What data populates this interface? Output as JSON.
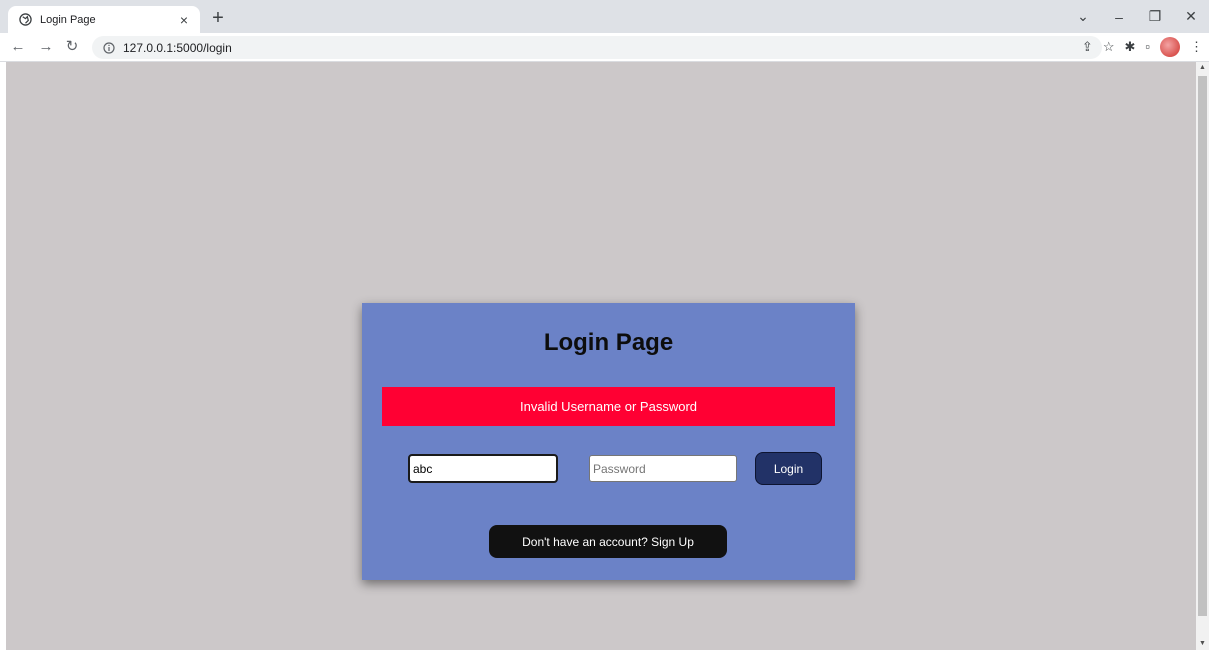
{
  "browser": {
    "tab_title": "Login Page",
    "tab_close": "×",
    "new_tab": "+",
    "url": "127.0.0.1:5000/login",
    "window_controls": {
      "dropdown": "⌄",
      "minimize": "–",
      "restore": "❐",
      "close": "✕"
    }
  },
  "page": {
    "title": "Login Page",
    "error_message": "Invalid Username or Password",
    "username_value": "abc",
    "password_placeholder": "Password",
    "login_label": "Login",
    "signup_label": "Don't have an account? Sign Up"
  },
  "colors": {
    "background": "#ccc8c9",
    "card": "#6b82c7",
    "error": "#ff0033",
    "login_button": "#223267",
    "signup_button": "#111111"
  },
  "icons": [
    "globe-icon",
    "close-icon",
    "plus-icon",
    "back-icon",
    "forward-icon",
    "reload-icon",
    "info-icon",
    "share-icon",
    "star-icon",
    "extensions-icon",
    "side-panel-icon",
    "avatar",
    "menu-icon"
  ]
}
